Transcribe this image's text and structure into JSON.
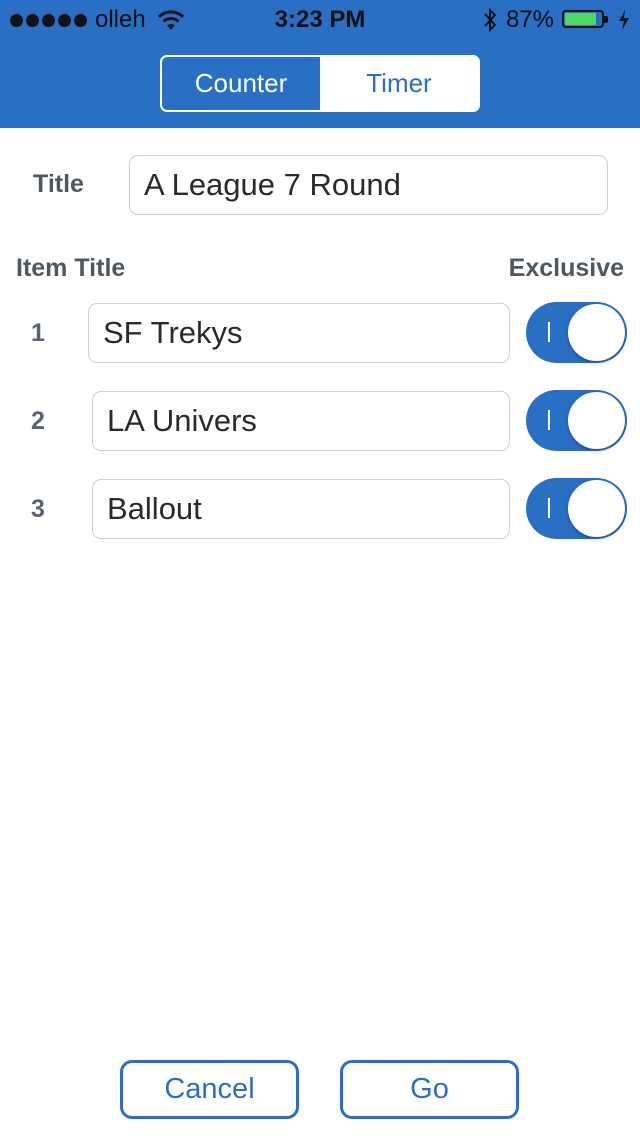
{
  "status_bar": {
    "carrier": "olleh",
    "time": "3:23 PM",
    "battery_percent": "87%",
    "battery_level": 0.87,
    "signal_dots": 5
  },
  "segmented_control": {
    "items": [
      {
        "label": "Counter",
        "selected": true
      },
      {
        "label": "Timer",
        "selected": false
      }
    ]
  },
  "form": {
    "title_label": "Title",
    "title_value": "A League 7 Round",
    "item_title_header": "Item Title",
    "exclusive_header": "Exclusive",
    "items": [
      {
        "number": "1",
        "title": "SF Trekys",
        "exclusive": true
      },
      {
        "number": "2",
        "title": "LA Univers",
        "exclusive": true
      },
      {
        "number": "3",
        "title": "Ballout",
        "exclusive": true
      }
    ]
  },
  "buttons": {
    "cancel_label": "Cancel",
    "go_label": "Go"
  },
  "colors": {
    "accent": "#2a6fc6",
    "battery_fill": "#4cd964"
  }
}
